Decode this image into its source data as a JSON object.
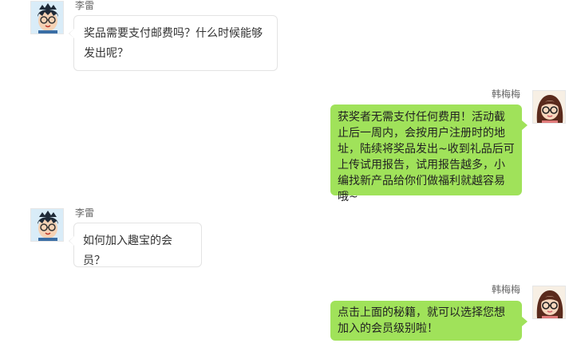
{
  "conversation": {
    "messages": [
      {
        "sender": "李雷",
        "side": "left",
        "avatar_icon": "boy-avatar-icon",
        "text": "奖品需要支付邮费吗？什么时候能够发出呢？"
      },
      {
        "sender": "韩梅梅",
        "side": "right",
        "avatar_icon": "girl-avatar-icon",
        "text": "获奖者无需支付任何费用！活动截止后一周内，会按用户注册时的地址，陆续将奖品发出~收到礼品后可上传试用报告，试用报告越多，小编找新产品给你们做福利就越容易哦~"
      },
      {
        "sender": "李雷",
        "side": "left",
        "avatar_icon": "boy-avatar-icon",
        "text": "如何加入趣宝的会员？"
      },
      {
        "sender": "韩梅梅",
        "side": "right",
        "avatar_icon": "girl-avatar-icon",
        "text": "点击上面的秘籍，就可以选择您想加入的会员级别啦！"
      }
    ]
  },
  "colors": {
    "left_bubble": "#ffffff",
    "left_bubble_border": "#e3e3e3",
    "right_bubble": "#a0e25a",
    "name_text": "#666666"
  }
}
